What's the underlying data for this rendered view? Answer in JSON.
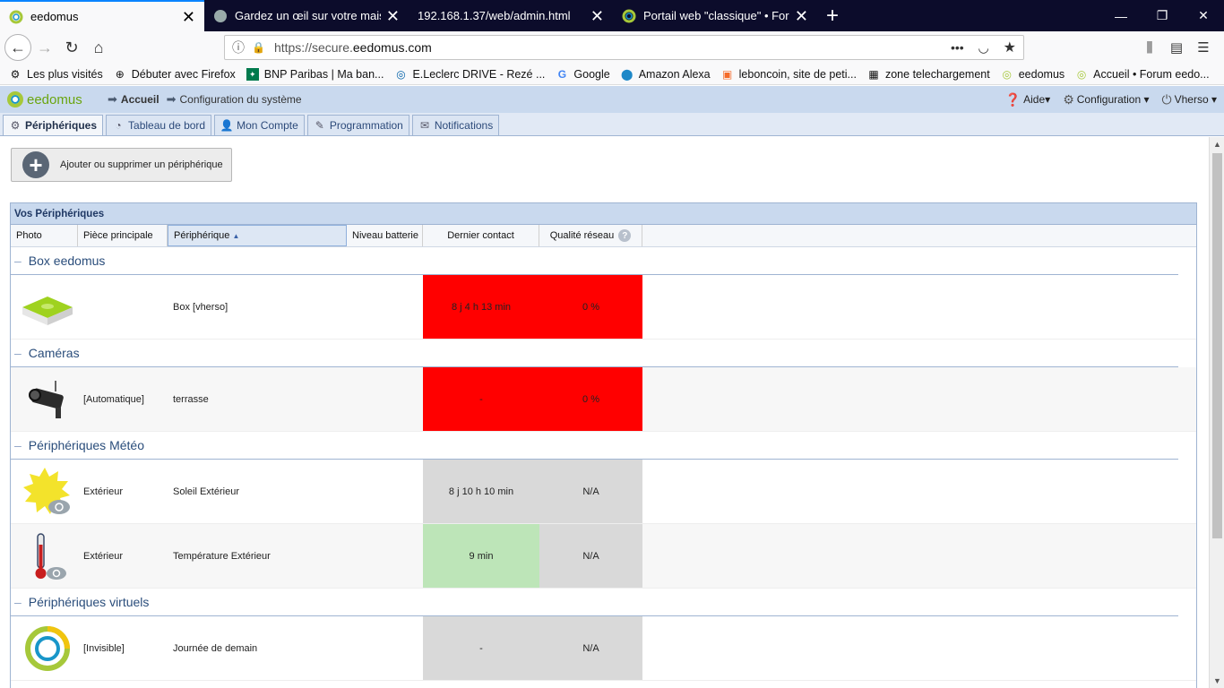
{
  "browser": {
    "tabs": [
      {
        "title": "eedomus",
        "active": true
      },
      {
        "title": "Gardez un œil sur votre maison",
        "active": false
      },
      {
        "title": "192.168.1.37/web/admin.html",
        "active": false
      },
      {
        "title": "Portail web \"classique\" • Forum",
        "active": false
      }
    ],
    "url_prefix": "https://secure.",
    "url_domain": "eedomus.com",
    "bookmarks": [
      "Les plus visités",
      "Débuter avec Firefox",
      "BNP Paribas | Ma ban...",
      "E.Leclerc DRIVE - Rezé ...",
      "Google",
      "Amazon Alexa",
      "leboncoin, site de peti...",
      "zone telechargement",
      "eedomus",
      "Accueil • Forum eedo..."
    ]
  },
  "app": {
    "logo_text": "eedomus",
    "breadcrumb_home": "Accueil",
    "breadcrumb_current": "Configuration du système",
    "help": "Aide",
    "config": "Configuration",
    "user": "Vherso",
    "tabs": [
      "Périphériques",
      "Tableau de bord",
      "Mon Compte",
      "Programmation",
      "Notifications"
    ]
  },
  "content": {
    "add_button": "Ajouter ou supprimer un périphérique",
    "panel_title": "Vos Périphériques",
    "columns": [
      "Photo",
      "Pièce principale",
      "Périphérique",
      "Niveau batterie",
      "Dernier contact",
      "Qualité réseau"
    ],
    "groups": [
      {
        "name": "Box eedomus",
        "rows": [
          {
            "icon": "eedomus-box-icon",
            "piece": "",
            "periph": "Box [vherso]",
            "battery": "",
            "contact": "8 j 4 h 13 min",
            "quality": "0 %",
            "contact_status": "red",
            "quality_status": "red"
          }
        ]
      },
      {
        "name": "Caméras",
        "rows": [
          {
            "icon": "camera-icon",
            "piece": "[Automatique]",
            "periph": "terrasse",
            "battery": "",
            "contact": "-",
            "quality": "0 %",
            "contact_status": "red",
            "quality_status": "red"
          }
        ]
      },
      {
        "name": "Périphériques Météo",
        "rows": [
          {
            "icon": "sun-icon",
            "piece": "Extérieur",
            "periph": "Soleil Extérieur",
            "battery": "",
            "contact": "8 j 10 h 10 min",
            "quality": "N/A",
            "contact_status": "grey",
            "quality_status": "grey"
          },
          {
            "icon": "thermometer-icon",
            "piece": "Extérieur",
            "periph": "Température Extérieur",
            "battery": "",
            "contact": "9 min",
            "quality": "N/A",
            "contact_status": "green",
            "quality_status": "grey"
          }
        ]
      },
      {
        "name": "Périphériques virtuels",
        "rows": [
          {
            "icon": "eedomus-ring-icon",
            "piece": "[Invisible]",
            "periph": "Journée de demain",
            "battery": "",
            "contact": "-",
            "quality": "N/A",
            "contact_status": "grey",
            "quality_status": "grey"
          }
        ]
      }
    ]
  },
  "colors": {
    "red": "#ff0000",
    "grey": "#d9d9d9",
    "green": "#bde5b8",
    "header_bg": "#c9d9ee"
  }
}
